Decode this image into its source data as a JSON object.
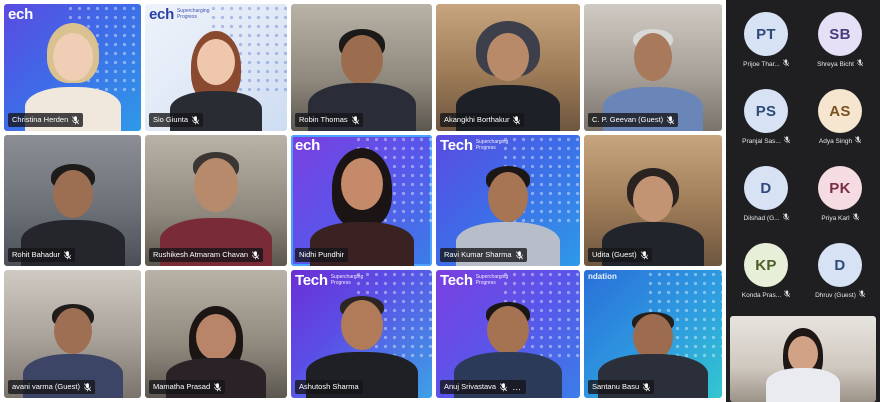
{
  "colors": {
    "tile_label_bg": "#141418",
    "speaker_outline": "#4aa3ff",
    "side_panel_bg": "#1f1f22"
  },
  "brand": {
    "word": "Tech",
    "word_cut": "ech",
    "sub": "Supercharging Progress",
    "foundation_cut": "ndation"
  },
  "tiles": [
    {
      "name": "Christina Herden",
      "muted": true
    },
    {
      "name": "Sio Giunta",
      "muted": true
    },
    {
      "name": "Robin Thomas",
      "muted": true
    },
    {
      "name": "Akangkhi Borthakur",
      "muted": true
    },
    {
      "name": "C. P. Geevan (Guest)",
      "muted": true
    },
    {
      "name": "Rohit Bahadur",
      "muted": true
    },
    {
      "name": "Rushikesh Atmaram Chavan",
      "muted": true
    },
    {
      "name": "Nidhi Pundhir",
      "muted": false,
      "speaking": true
    },
    {
      "name": "Ravi Kumar Sharma",
      "muted": true
    },
    {
      "name": "Udita (Guest)",
      "muted": true
    },
    {
      "name": "avani varma (Guest)",
      "muted": true
    },
    {
      "name": "Mamatha Prasad",
      "muted": true
    },
    {
      "name": "Ashutosh Sharma",
      "muted": false
    },
    {
      "name": "Anuj Srivastava",
      "muted": true,
      "more": "…"
    },
    {
      "name": "Santanu Basu",
      "muted": true
    }
  ],
  "sidebar": {
    "participants": [
      {
        "initials": "PT",
        "name": "Prijoe Thar...",
        "avatar_bg": "#d7e3f5",
        "avatar_fg": "#2f4a78"
      },
      {
        "initials": "SB",
        "name": "Shreya Bicht",
        "avatar_bg": "#e6e0f6",
        "avatar_fg": "#4b3b7c"
      },
      {
        "initials": "PS",
        "name": "Pranjal Sas...",
        "avatar_bg": "#d7e3f5",
        "avatar_fg": "#2f4a78"
      },
      {
        "initials": "AS",
        "name": "Adya Singh",
        "avatar_bg": "#f6e6cf",
        "avatar_fg": "#7a5220"
      },
      {
        "initials": "D",
        "name": "Dilshad (G...",
        "avatar_bg": "#d7e3f5",
        "avatar_fg": "#2f4a78"
      },
      {
        "initials": "PK",
        "name": "Priya Karl",
        "avatar_bg": "#f5dbe2",
        "avatar_fg": "#7a2e44"
      },
      {
        "initials": "KP",
        "name": "Konda Pras...",
        "avatar_bg": "#e7efd8",
        "avatar_fg": "#4a5f2a"
      },
      {
        "initials": "D",
        "name": "Dhruv (Guest)",
        "avatar_bg": "#d7e3f5",
        "avatar_fg": "#2f4a78"
      }
    ]
  }
}
